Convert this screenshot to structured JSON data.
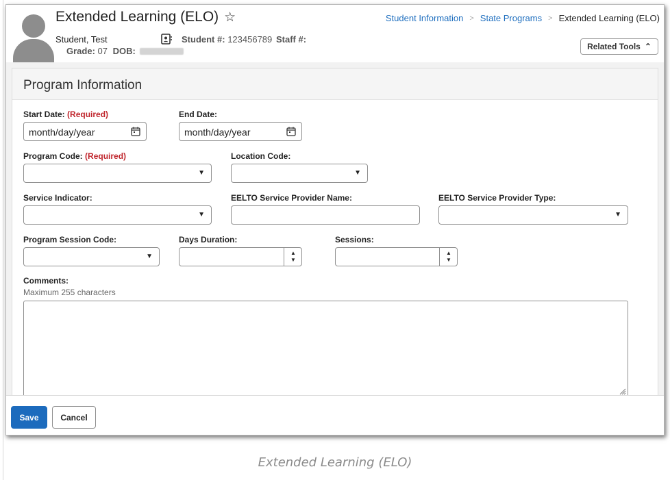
{
  "header": {
    "title": "Extended Learning (ELO)",
    "star_icon": "star-icon",
    "student_name": "Student, Test",
    "grade_label": "Grade:",
    "grade_value": "07",
    "dob_label": "DOB:",
    "student_num_label": "Student #:",
    "student_num_value": "123456789",
    "staff_num_label": "Staff #:",
    "related_tools_label": "Related Tools"
  },
  "breadcrumb": {
    "items": [
      "Student Information",
      "State Programs",
      "Extended Learning (ELO)"
    ]
  },
  "panel": {
    "title": "Program Information"
  },
  "form": {
    "start_date": {
      "label": "Start Date:",
      "required": "(Required)",
      "value": "month/day/year"
    },
    "end_date": {
      "label": "End Date:",
      "value": "month/day/year"
    },
    "program_code": {
      "label": "Program Code:",
      "required": "(Required)",
      "value": ""
    },
    "location_code": {
      "label": "Location Code:",
      "value": ""
    },
    "service_indicator": {
      "label": "Service Indicator:",
      "value": ""
    },
    "provider_name": {
      "label": "EELTO Service Provider Name:",
      "value": ""
    },
    "provider_type": {
      "label": "EELTO Service Provider Type:",
      "value": ""
    },
    "session_code": {
      "label": "Program Session Code:",
      "value": ""
    },
    "days_duration": {
      "label": "Days Duration:",
      "value": ""
    },
    "sessions": {
      "label": "Sessions:",
      "value": ""
    },
    "comments": {
      "label": "Comments:",
      "hint": "Maximum 255 characters",
      "value": ""
    }
  },
  "footer": {
    "save_label": "Save",
    "cancel_label": "Cancel"
  },
  "caption": "Extended Learning (ELO)",
  "colors": {
    "link": "#1f6fbf",
    "primary_button": "#1c6bbd",
    "required": "#c0262d"
  }
}
